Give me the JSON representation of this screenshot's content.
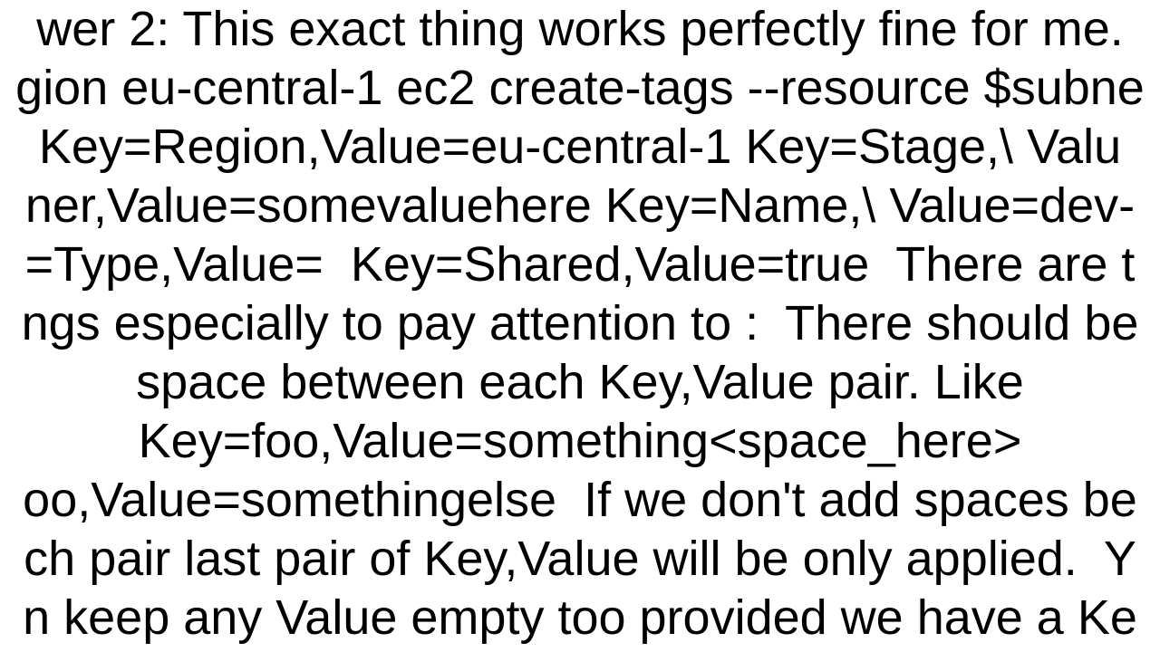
{
  "answer": {
    "label": "wer 2:",
    "intro": "This exact thing works perfectly fine for me.",
    "cmd_parts": {
      "p1": "gion eu-central-1 ec2 create-tags --resource $subne",
      "p2": "Key=Region,Value=eu-central-1 Key=Stage,\\ Valu",
      "p3": "ner,Value=somevaluehere Key=Name,\\ Value=dev-",
      "p4": "=Type,Value=  Key=Shared,Value=true"
    },
    "notes": {
      "lead": "There are t",
      "line2": "ngs especially to pay attention to :  There should be",
      "line3": "space between each Key,Value pair. Like",
      "line4": "Key=foo,Value=something<space_here>",
      "line5": "oo,Value=somethingelse  If we don't add spaces be",
      "line6": "ch pair last pair of Key,Value will be only applied.  Y",
      "line7": "n keep any Value empty too provided we have a Ke"
    }
  }
}
